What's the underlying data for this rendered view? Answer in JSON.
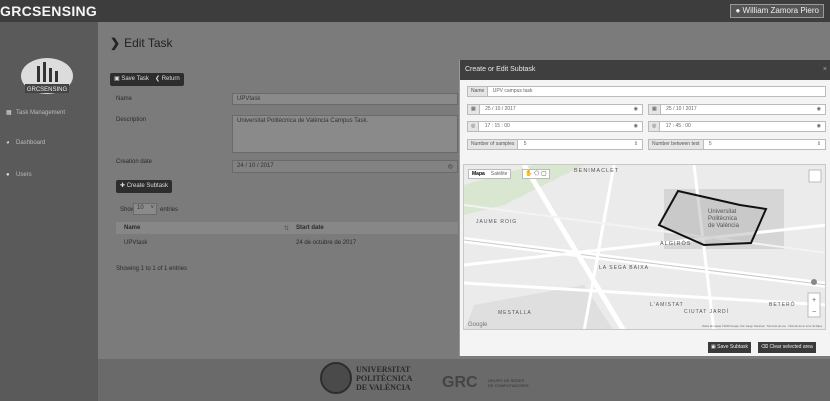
{
  "app": {
    "brand": "GRCSENSING",
    "user_name": "William Zamora Piero"
  },
  "sidebar": {
    "logo_text": "GRCSENSING",
    "items": [
      {
        "label": "Task Management"
      },
      {
        "label": "Dashboard"
      },
      {
        "label": "Users"
      }
    ]
  },
  "page": {
    "title": "Edit Task"
  },
  "toolbar": {
    "save_label": "Save Task",
    "return_label": "Return"
  },
  "form": {
    "name_label": "Name",
    "name_value": "UPVtask",
    "description_label": "Description",
    "description_value": "Universitat Politècnica de València Campus Task.",
    "creation_date_label": "Creation date",
    "creation_date_value": "24 / 10 / 2017"
  },
  "subtasks": {
    "create_label": "Create Subtask",
    "show_label": "Show",
    "entries_count": "10",
    "entries_label": "entries",
    "columns": [
      "Name",
      "Start date"
    ],
    "rows": [
      {
        "name": "UPVtask",
        "start_date": "24 de octubre de 2017"
      }
    ],
    "summary": "Showing 1 to 1 of 1 entries"
  },
  "modal": {
    "title": "Create or Edit Subtask",
    "close": "×",
    "name_label": "Name",
    "name_value": "UPV campus task",
    "start_date": "25 / 10 / 2017",
    "end_date": "25 / 10 / 2017",
    "start_time": "17 : 15 : 00",
    "end_time": "17 : 45 : 00",
    "samples_label": "Number of samples",
    "samples_value": "5",
    "between_label": "Number between test",
    "between_value": "5",
    "save_label": "Save Subtask",
    "clear_label": "Clear selected area"
  },
  "map": {
    "map_tab": "Mapa",
    "sat_tab": "Satélite",
    "places": [
      {
        "label": "BENIMACLET"
      },
      {
        "label": "Universitat Politècnica de València"
      },
      {
        "label": "ALGIRÓS"
      },
      {
        "label": "JAUME ROIG"
      },
      {
        "label": "LA SEGA BAIXA"
      },
      {
        "label": "MESTALLA"
      },
      {
        "label": "CIUTAT JARDÍ"
      },
      {
        "label": "L'AMISTAT"
      },
      {
        "label": "BETERÓ"
      },
      {
        "label": "Google"
      }
    ],
    "attribution": "Datos de mapas ©2018 Google, Inst. Geogr. Nacional · Términos de uso · Informar de un error de Maps"
  }
}
